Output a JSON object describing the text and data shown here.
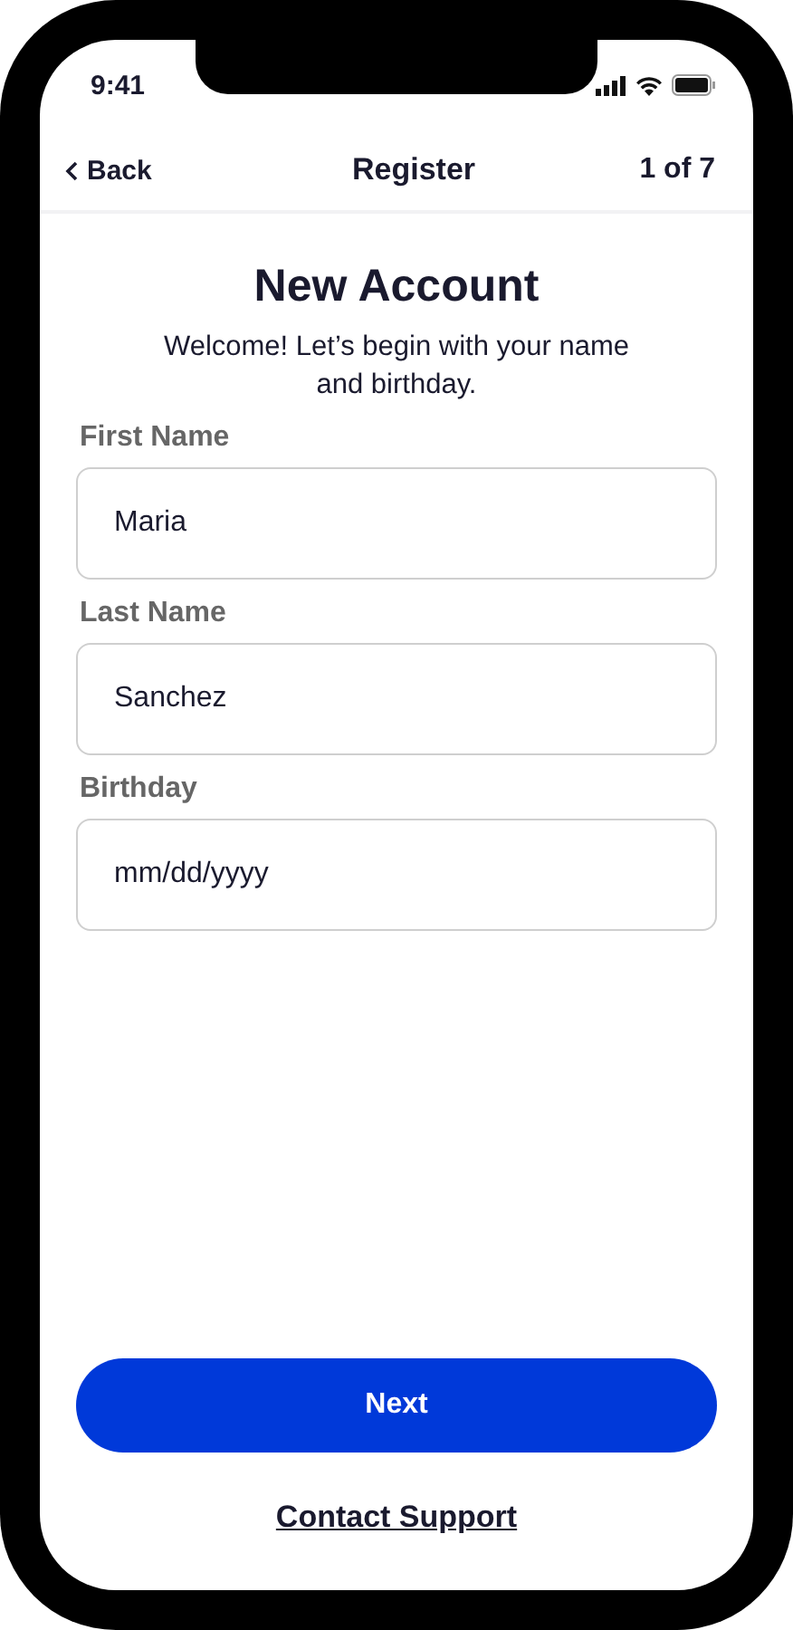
{
  "status_bar": {
    "time": "9:41"
  },
  "header": {
    "back": "Back",
    "title": "Register",
    "step": "1 of 7"
  },
  "heading": "New Account",
  "subtitle": "Welcome! Let’s begin with your name and birthday.",
  "fields": [
    {
      "label": "First Name",
      "value": "Maria"
    },
    {
      "label": "Last Name",
      "value": "Sanchez"
    },
    {
      "label": "Birthday",
      "value": "mm/dd/yyyy"
    }
  ],
  "primary_button": "Next",
  "link": "Contact Support"
}
